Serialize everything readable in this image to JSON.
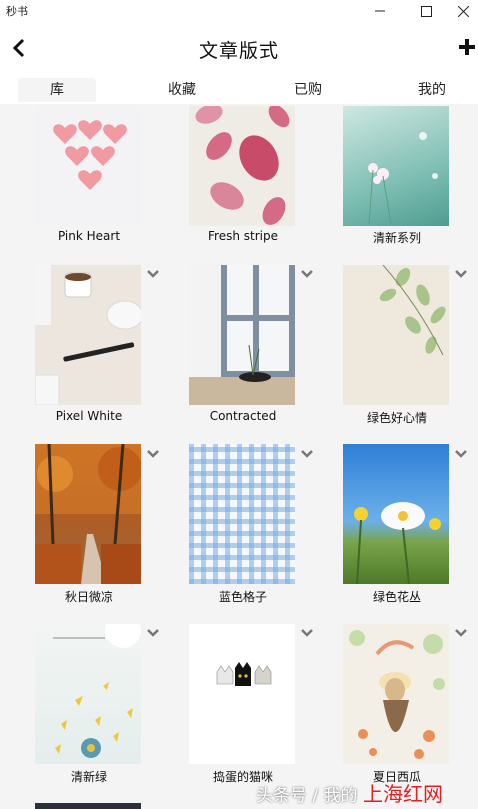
{
  "window": {
    "app_title": "秒书"
  },
  "header": {
    "title": "文章版式"
  },
  "tabs": [
    {
      "label": "库"
    },
    {
      "label": "收藏"
    },
    {
      "label": "已购"
    },
    {
      "label": "我的"
    }
  ],
  "templates": [
    {
      "label": "Pink Heart"
    },
    {
      "label": "Fresh stripe"
    },
    {
      "label": "清新系列"
    },
    {
      "label": "Pixel White"
    },
    {
      "label": "Contracted"
    },
    {
      "label": "绿色好心情"
    },
    {
      "label": "秋日微凉"
    },
    {
      "label": "蓝色格子"
    },
    {
      "label": "绿色花丛"
    },
    {
      "label": "清新绿"
    },
    {
      "label": "捣蛋的猫咪"
    },
    {
      "label": "夏日西瓜"
    }
  ],
  "watermark": {
    "text": "头条号 / 我的",
    "brand": "上海红网"
  },
  "colors": {
    "accent": "#111111",
    "background": "#f4f4f4",
    "watermark_brand": "#e02020"
  }
}
